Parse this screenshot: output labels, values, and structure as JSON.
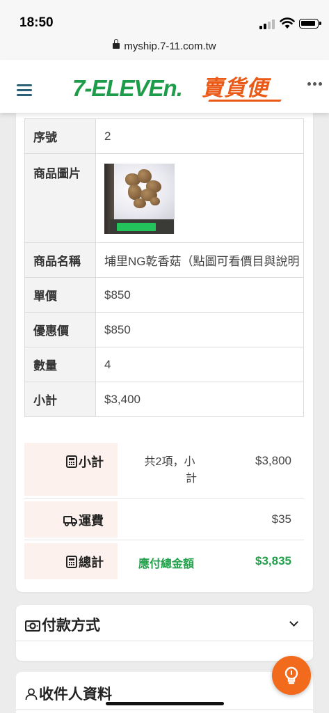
{
  "status_bar": {
    "time": "18:50"
  },
  "browser": {
    "url": "myship.7-11.com.tw"
  },
  "header": {
    "brand_primary": "7-ELEVEn.",
    "brand_secondary": "賣貨便"
  },
  "item_table": {
    "rows": [
      {
        "label": "序號",
        "value": "2"
      },
      {
        "label": "商品圖片",
        "value": ""
      },
      {
        "label": "商品名稱",
        "value": "埔里NG乾香菇（點圖可看價目與說明"
      },
      {
        "label": "單價",
        "value": "$850"
      },
      {
        "label": "優惠價",
        "value": "$850"
      },
      {
        "label": "數量",
        "value": "4"
      },
      {
        "label": "小計",
        "value": "$3,400"
      }
    ]
  },
  "summary": {
    "subtotal": {
      "label": "小計",
      "description_line1": "共2項，小",
      "description_line2": "計",
      "amount": "$3,800"
    },
    "shipping": {
      "label": "運費",
      "amount": "$35"
    },
    "total": {
      "label": "總計",
      "description": "應付總金額",
      "amount": "$3,835"
    }
  },
  "sections": {
    "payment_title": "付款方式",
    "recipient_title": "收件人資料"
  },
  "colors": {
    "brand_green": "#1d9c4a",
    "brand_orange": "#ea5a16",
    "total_green": "#22a04a",
    "label_bg": "#fdf1ed"
  }
}
